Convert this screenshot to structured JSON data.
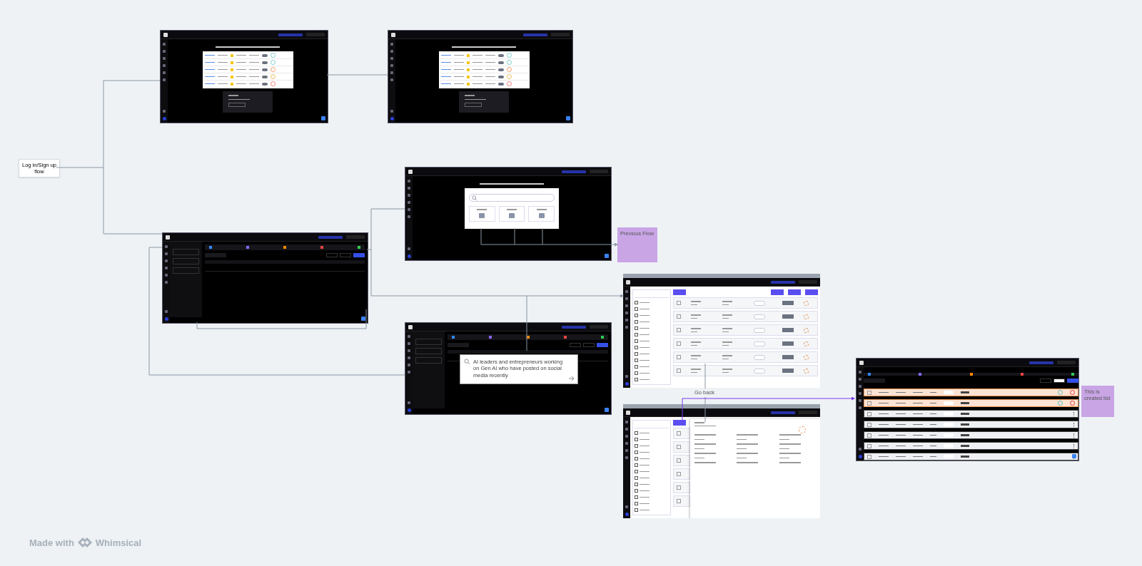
{
  "canvas": {
    "flow_label": "Log in/Sign up flow",
    "go_back_label": "Go back",
    "search_prompt": "AI leaders and entrepreneurs working on Gen AI who have posted on social media recently",
    "sticky_notes": [
      {
        "title": "Previous Flow",
        "color": "#c9a5e6"
      },
      {
        "title": "This is created list",
        "color": "#c9a5e6"
      }
    ],
    "frame_8": {
      "rows": [
        {
          "selected": true
        },
        {
          "selected": true
        },
        {
          "selected": false
        },
        {
          "selected": false
        },
        {
          "selected": false
        },
        {
          "selected": false
        },
        {
          "selected": false
        }
      ]
    }
  },
  "footer": {
    "prefix": "Made with",
    "brand": "Whimsical"
  }
}
